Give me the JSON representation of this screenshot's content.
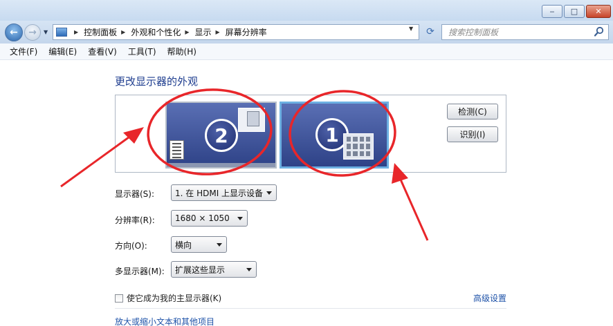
{
  "window": {
    "minimize_glyph": "‒",
    "maximize_glyph": "□",
    "close_glyph": "✕"
  },
  "address": {
    "breadcrumbs": [
      "控制面板",
      "外观和个性化",
      "显示",
      "屏幕分辨率"
    ],
    "search_placeholder": "搜索控制面板"
  },
  "menu": [
    "文件(F)",
    "编辑(E)",
    "查看(V)",
    "工具(T)",
    "帮助(H)"
  ],
  "page": {
    "title": "更改显示器的外观",
    "monitors": [
      {
        "number": "2"
      },
      {
        "number": "1"
      }
    ],
    "detect_label": "检测(C)",
    "identify_label": "识别(I)",
    "display_label": "显示器(S):",
    "display_value": "1. 在 HDMI 上显示设备",
    "resolution_label": "分辨率(R):",
    "resolution_value": "1680 × 1050",
    "orientation_label": "方向(O):",
    "orientation_value": "横向",
    "multi_label": "多显示器(M):",
    "multi_value": "扩展这些显示",
    "primary_checkbox_label": "使它成为我的主显示器(K)",
    "advanced_link": "高级设置",
    "textsize_link": "放大或缩小文本和其他项目"
  },
  "colors": {
    "annotation_red": "#e8262a",
    "link_blue": "#1e52a8",
    "heading_blue": "#1e3d8f"
  }
}
